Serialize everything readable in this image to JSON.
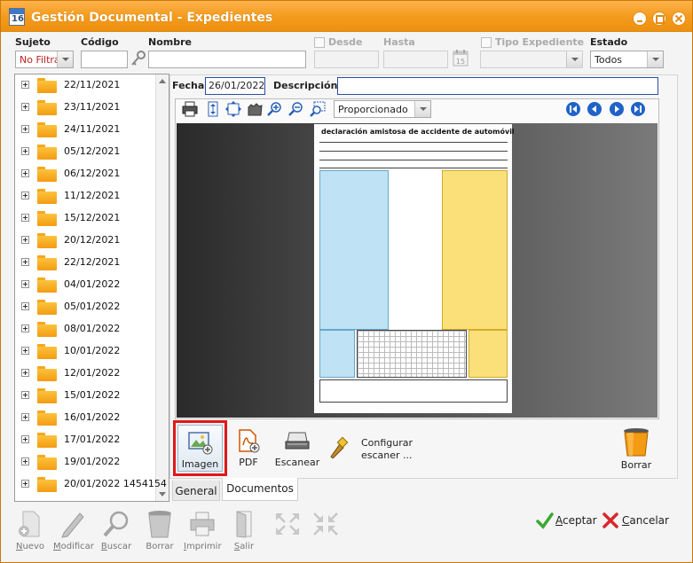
{
  "window": {
    "title": "Gestión Documental - Expedientes",
    "app_icon_text": "16"
  },
  "filters": {
    "sujeto_label": "Sujeto",
    "sujeto_value": "No Filtrar",
    "codigo_label": "Código",
    "codigo_value": "",
    "nombre_label": "Nombre",
    "nombre_value": "",
    "desde_label": "Desde",
    "hasta_label": "Hasta",
    "calendar_icon_text": "15",
    "tipo_label": "Tipo Expediente",
    "estado_label": "Estado",
    "estado_value": "Todos"
  },
  "tree": {
    "items": [
      "22/11/2021",
      "23/11/2021",
      "24/11/2021",
      "05/12/2021",
      "06/12/2021",
      "11/12/2021",
      "15/12/2021",
      "20/12/2021",
      "22/12/2021",
      "04/01/2022",
      "05/01/2022",
      "08/01/2022",
      "10/01/2022",
      "12/01/2022",
      "15/01/2022",
      "16/01/2022",
      "17/01/2022",
      "19/01/2022",
      "20/01/2022 1454154"
    ]
  },
  "detail": {
    "fecha_label": "Fecha",
    "fecha_value": "26/01/2022",
    "descripcion_label": "Descripción",
    "descripcion_value": "",
    "zoom_mode": "Proporcionado",
    "doc_title": "declaración amistosa de accidente de automóvil"
  },
  "doc_toolbar": {
    "imagen": "Imagen",
    "pdf": "PDF",
    "escanear": "Escanear",
    "configurar": "Configurar",
    "escaner": "escaner ...",
    "borrar": "Borrar"
  },
  "tabs": {
    "general": "General",
    "documentos": "Documentos"
  },
  "actions": {
    "nuevo_u": "N",
    "nuevo_rest": "uevo",
    "modificar_u": "M",
    "modificar_rest": "odificar",
    "buscar_u": "B",
    "buscar_rest": "uscar",
    "borrar": "Borrar",
    "imprimir_u": "I",
    "imprimir_rest": "mprimir",
    "salir_u": "S",
    "salir_rest": "alir",
    "aceptar_u": "A",
    "aceptar_rest": "ceptar",
    "cancelar_u": "C",
    "cancelar_rest": "ancelar"
  },
  "colors": {
    "titlebar": "#f39a1c",
    "folder": "#f39c12",
    "highlight": "#e01818",
    "nav": "#1f63c8",
    "accept": "#3aa832",
    "cancel": "#d9262c"
  }
}
